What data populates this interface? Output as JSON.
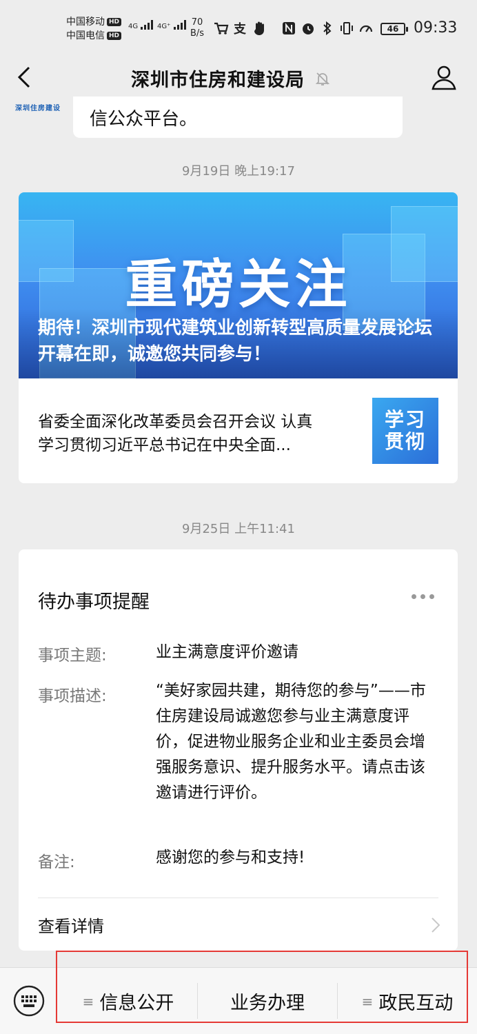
{
  "status_bar": {
    "carrier_1": "中国移动",
    "carrier_2": "中国电信",
    "hd_badge": "HD",
    "net_type_1": "4G",
    "net_type_2": "4G⁺",
    "net_speed_value": "70",
    "net_speed_unit": "B/s",
    "battery": "46",
    "time": "09:33",
    "icons": [
      "cart-icon",
      "alipay-icon",
      "hand-icon",
      "nfc-icon",
      "alarm-icon",
      "bluetooth-icon",
      "vibrate-icon",
      "speedometer-icon"
    ]
  },
  "nav": {
    "title": "深圳市住房和建设局",
    "icons": [
      "back-arrow-icon",
      "mute-bell-icon",
      "profile-icon"
    ]
  },
  "top_message": {
    "logo_text": "深圳住房建设",
    "text": "信公众平台。"
  },
  "messages": [
    {
      "timestamp": "9月19日 晚上19:17"
    },
    {
      "timestamp": "9月25日 上午11:41"
    }
  ],
  "article": {
    "banner_heading": "重磅关注",
    "banner_caption": "期待！深圳市现代建筑业创新转型高质量发展论坛开幕在即，诚邀您共同参与！",
    "sub_title_line1": "省委全面深化改革委员会召开会议 认真",
    "sub_title_line2": "学习贯彻习近平总书记在中央全面...",
    "thumb_line1": "学习",
    "thumb_line2": "贯彻"
  },
  "todo": {
    "title": "待办事项提醒",
    "fields": [
      {
        "label": "事项主题:",
        "value": "业主满意度评价邀请"
      },
      {
        "label": "事项描述:",
        "value": "“美好家园共建，期待您的参与”——市住房建设局诚邀您参与业主满意度评价，促进物业服务企业和业主委员会增强服务意识、提升服务水平。请点击该邀请进行评价。"
      },
      {
        "label": "备注:",
        "value": "感谢您的参与和支持!"
      }
    ],
    "detail_link": "查看详情"
  },
  "bottom_menu": {
    "items": [
      "信息公开",
      "业务办理",
      "政民互动"
    ],
    "ham_glyph": "≡"
  }
}
